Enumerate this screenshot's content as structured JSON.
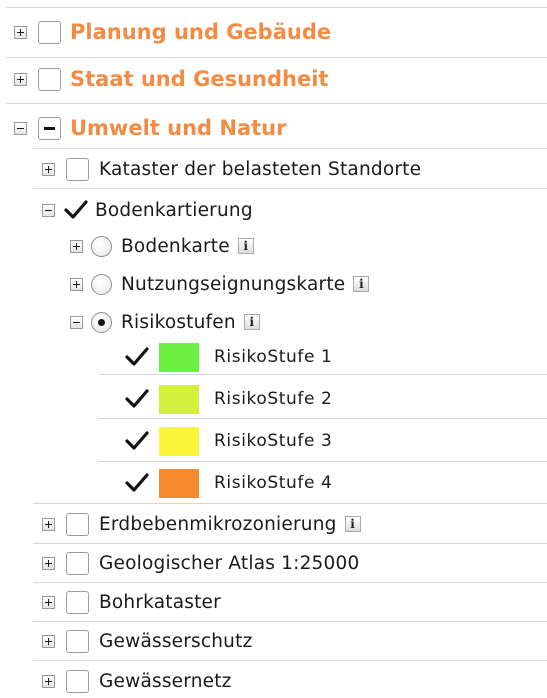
{
  "colors": {
    "category_text": "#f28c44",
    "separator": "#d6d6d6",
    "risk_level_1": "#6ef041",
    "risk_level_2": "#d3f03c",
    "risk_level_3": "#f9f739",
    "risk_level_4": "#f5892e"
  },
  "categories": [
    {
      "label": "Planung und Gebäude",
      "expanded": false,
      "checkbox": "unchecked"
    },
    {
      "label": "Staat und Gesundheit",
      "expanded": false,
      "checkbox": "unchecked"
    },
    {
      "label": "Umwelt und Natur",
      "expanded": true,
      "checkbox": "partial"
    }
  ],
  "umwelt_layers": {
    "kataster_belasteter_standorte": {
      "label": "Kataster der belasteten Standorte",
      "checked": false
    },
    "bodenkartierung": {
      "label": "Bodenkartierung",
      "checked": true,
      "children": [
        {
          "label": "Bodenkarte",
          "selected": false,
          "info_icon": "i"
        },
        {
          "label": "Nutzungseignungskarte",
          "selected": false,
          "info_icon": "i"
        },
        {
          "label": "Risikostufen",
          "selected": true,
          "info_icon": "i"
        }
      ],
      "legend": [
        {
          "label": "RisikoStufe 1",
          "checked": true,
          "color": "#6ef041"
        },
        {
          "label": "RisikoStufe 2",
          "checked": true,
          "color": "#d3f03c"
        },
        {
          "label": "RisikoStufe 3",
          "checked": true,
          "color": "#f9f739"
        },
        {
          "label": "RisikoStufe 4",
          "checked": true,
          "color": "#f5892e"
        }
      ]
    },
    "erdbebenmikrozonierung": {
      "label": "Erdbebenmikrozonierung",
      "checked": false,
      "info_icon": "i"
    },
    "geologischer_atlas": {
      "label": "Geologischer Atlas 1:25000",
      "checked": false
    },
    "bohrkataster": {
      "label": "Bohrkataster",
      "checked": false
    },
    "gewaesserschutz": {
      "label": "Gewässerschutz",
      "checked": false
    },
    "gewaessernetz": {
      "label": "Gewässernetz",
      "checked": false
    }
  }
}
